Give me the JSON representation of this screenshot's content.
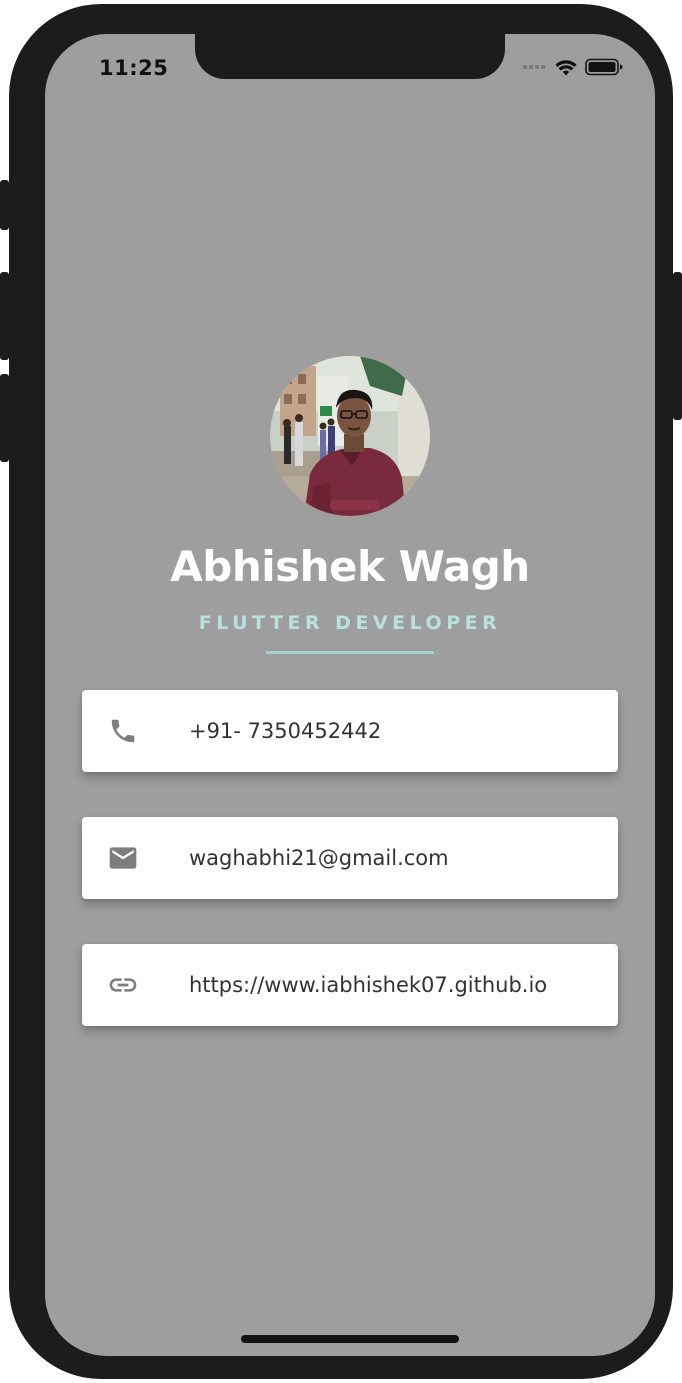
{
  "status_bar": {
    "time": "11:25",
    "icons": [
      "cellular-dots-icon",
      "wifi-icon",
      "battery-icon"
    ]
  },
  "profile": {
    "avatar": "profile-photo",
    "name": "Abhishek Wagh",
    "title": "FLUTTER DEVELOPER"
  },
  "contacts": [
    {
      "icon": "phone-icon",
      "text": "+91- 7350452442"
    },
    {
      "icon": "email-icon",
      "text": "waghabhi21@gmail.com"
    },
    {
      "icon": "link-icon",
      "text": "https://www.iabhishek07.github.io"
    }
  ],
  "colors": {
    "background": "#9e9e9e",
    "accent": "#b9e2df",
    "card": "#ffffff",
    "icon": "#7d7d7d"
  }
}
